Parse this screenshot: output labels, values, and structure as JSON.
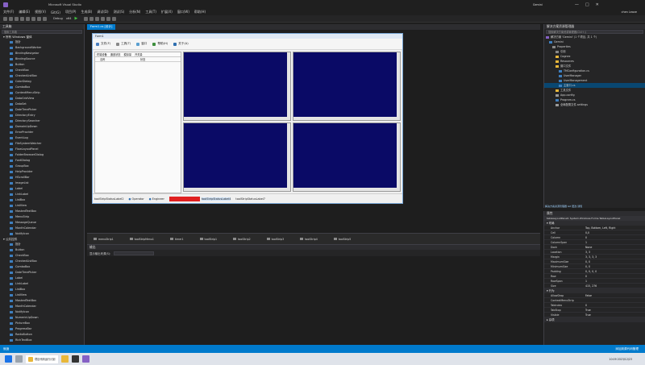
{
  "title_bar": {
    "title": "Microsoft Visual Studio",
    "notification": "Gemini",
    "user": "chen Leave"
  },
  "menu": [
    "文件(F)",
    "编辑(E)",
    "视图(V)",
    "Git(G)",
    "项目(P)",
    "生成(B)",
    "调试(D)",
    "测试(S)",
    "分析(N)",
    "工具(T)",
    "扩展(X)",
    "窗口(W)",
    "帮助(H)"
  ],
  "toolbar": {
    "config": "Debug",
    "platform": "x64"
  },
  "toolbox": {
    "title": "工具箱",
    "search_placeholder": "搜索工具箱",
    "group1": "所有 Windows 窗体",
    "items1": [
      "指针",
      "BackgroundWorker",
      "BindingNavigator",
      "BindingSource",
      "Button",
      "CheckBox",
      "CheckedListBox",
      "ColorDialog",
      "ComboBox",
      "ContextMenuStrip",
      "DataGridView",
      "DataSet",
      "DateTimePicker",
      "DirectoryEntry",
      "DirectorySearcher",
      "DomainUpDown",
      "ErrorProvider",
      "EventLog",
      "FileSystemWatcher",
      "FlowLayoutPanel",
      "FolderBrowserDialog",
      "FontDialog",
      "GroupBox",
      "HelpProvider",
      "HScrollBar",
      "ImageList",
      "Label",
      "LinkLabel",
      "ListBox",
      "ListView",
      "MaskedTextBox",
      "MenuStrip",
      "MessageQueue",
      "MonthCalendar",
      "NotifyIcon"
    ],
    "group2": "公共控件",
    "items2": [
      "指针",
      "Button",
      "CheckBox",
      "CheckedListBox",
      "ComboBox",
      "DateTimePicker",
      "Label",
      "LinkLabel",
      "ListBox",
      "ListView",
      "MaskedTextBox",
      "MonthCalendar",
      "NotifyIcon",
      "NumericUpDown",
      "PictureBox",
      "ProgressBar",
      "RadioButton",
      "RichTextBox"
    ]
  },
  "doc_tab": "Form1.cs [设计]",
  "form": {
    "title": "Form1",
    "menu": [
      "文件(F)",
      "工具(T)",
      "窗口",
      "帮助(H)",
      "关于(A)"
    ],
    "left_tabs": [
      "终端设备",
      "通道状态",
      "模拟量",
      "开关量"
    ],
    "left_headers": [
      "名称",
      "状态"
    ],
    "status_items": [
      "toolStripStatusLabel2",
      "Operator",
      "Engineer",
      "toolStripStatusLabel4",
      "toolStripStatusLabel7"
    ]
  },
  "tray": [
    "menuStrip1",
    "toolStripMenu1",
    "timer1",
    "toolStrip1",
    "toolStrip2",
    "toolStrip3",
    "toolStrip4",
    "toolStrip5"
  ],
  "output": {
    "title": "输出",
    "source_label": "显示输出来源(S):"
  },
  "solution": {
    "title": "解决方案资源管理器",
    "search_placeholder": "搜索解决方案资源管理器(Ctrl+;)",
    "items": [
      "解决方案 'Gemini' (1 个项目, 共 1 个)",
      "Gemini",
      "Properties",
      "引用",
      "Cognex",
      "Resources",
      "窗口文件",
      "TMConfiguration.cs",
      "UserManager",
      "UserManagement",
      "主窗口.cs",
      "工具文件",
      "App.config",
      "Program.cs",
      "全局配置文件.settings"
    ],
    "footer": "解决方案资源管理器  Git 更改  通知"
  },
  "properties": {
    "title": "属性",
    "object": "tableLayoutPanel1  System.Windows.Forms.TableLayoutPanel",
    "cat_layout": "布局",
    "rows": [
      [
        "Anchor",
        "Top, Bottom, Left, Right"
      ],
      [
        "Cell",
        "0,0"
      ],
      [
        "Column",
        "0"
      ],
      [
        "ColumnSpan",
        "1"
      ],
      [
        "Dock",
        "None"
      ],
      [
        "Location",
        "3, 3"
      ],
      [
        "Margin",
        "3, 3, 3, 3"
      ],
      [
        "MaximumSize",
        "0, 0"
      ],
      [
        "MinimumSize",
        "0, 0"
      ],
      [
        "Padding",
        "0, 0, 0, 0"
      ],
      [
        "Row",
        "0"
      ],
      [
        "RowSpan",
        "1"
      ],
      [
        "Size",
        "415, 276"
      ]
    ],
    "cat_behavior": "行为",
    "rows2": [
      [
        "AllowDrop",
        "False"
      ],
      [
        "ContextMenuStrip",
        ""
      ],
      [
        "TabIndex",
        "0"
      ],
      [
        "TabStop",
        "True"
      ],
      [
        "Visible",
        "True"
      ]
    ],
    "cat_design": "杂项"
  },
  "status_bar": {
    "left": "就绪",
    "right": "添加到源代码管理"
  },
  "taskbar": {
    "time": "10:09 2023/12/23",
    "app": "项目代码运行计划"
  }
}
